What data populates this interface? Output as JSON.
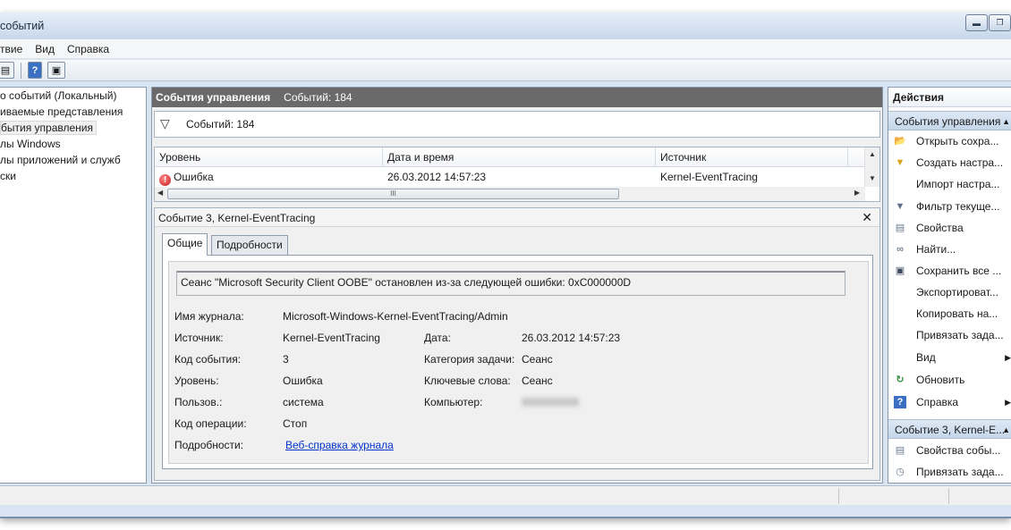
{
  "window": {
    "title": "событий"
  },
  "menubar": {
    "items": [
      "твие",
      "Вид",
      "Справка"
    ]
  },
  "tree": {
    "items": [
      {
        "label": "о событий (Локальный)",
        "selected": false
      },
      {
        "label": "иваемые представления",
        "selected": false
      },
      {
        "label": "бытия управления",
        "selected": true
      },
      {
        "label": "лы Windows",
        "selected": false
      },
      {
        "label": "лы приложений и служб",
        "selected": false
      },
      {
        "label": "ски",
        "selected": false
      }
    ]
  },
  "center": {
    "header_title": "События управления",
    "header_count": "Событий: 184",
    "filter_text": "Событий: 184",
    "columns": [
      "Уровень",
      "Дата и время",
      "Источник"
    ],
    "rows": [
      {
        "level": "Ошибка",
        "datetime": "26.03.2012 14:57:23",
        "source": "Kernel-EventTracing"
      }
    ],
    "hscroll_thumb": "III"
  },
  "detail": {
    "title": "Событие 3, Kernel-EventTracing",
    "close": "✕",
    "tabs": [
      "Общие",
      "Подробности"
    ],
    "message": "Сеанс \"Microsoft Security Client OOBE\" остановлен из-за следующей ошибки: 0xC000000D",
    "fields": {
      "log_name_label": "Имя журнала:",
      "log_name_value": "Microsoft-Windows-Kernel-EventTracing/Admin",
      "source_label": "Источник:",
      "source_value": "Kernel-EventTracing",
      "date_label": "Дата:",
      "date_value": "26.03.2012 14:57:23",
      "event_id_label": "Код события:",
      "event_id_value": "3",
      "task_category_label": "Категория задачи:",
      "task_category_value": "Сеанс",
      "level_label": "Уровень:",
      "level_value": "Ошибка",
      "keywords_label": "Ключевые слова:",
      "keywords_value": "Сеанс",
      "user_label": "Пользов.:",
      "user_value": "система",
      "computer_label": "Компьютер:",
      "computer_value": "XXXXXXXX",
      "opcode_label": "Код операции:",
      "opcode_value": "Стоп",
      "details_label": "Подробности:",
      "details_link": "Веб-справка журнала"
    }
  },
  "actions": {
    "title": "Действия",
    "section1": "События управления",
    "section1_items": [
      {
        "label": "Открыть сохра...",
        "icon": "open-folder-icon"
      },
      {
        "label": "Создать настра...",
        "icon": "create-view-filter-icon"
      },
      {
        "label": "Импорт настра...",
        "icon": "none"
      },
      {
        "label": "Фильтр текуще...",
        "icon": "filter-icon"
      },
      {
        "label": "Свойства",
        "icon": "properties-icon"
      },
      {
        "label": "Найти...",
        "icon": "binoculars-icon"
      },
      {
        "label": "Сохранить все ...",
        "icon": "save-icon"
      },
      {
        "label": "Экспортироват...",
        "icon": "none"
      },
      {
        "label": "Копировать на...",
        "icon": "none"
      },
      {
        "label": "Привязать зада...",
        "icon": "none"
      },
      {
        "label": "Вид",
        "icon": "none",
        "submenu": true
      },
      {
        "label": "Обновить",
        "icon": "refresh-icon"
      },
      {
        "label": "Справка",
        "icon": "help-icon",
        "submenu": true
      }
    ],
    "section2": "Событие 3, Kernel-E...",
    "section2_items": [
      {
        "label": "Свойства собы...",
        "icon": "event-properties-icon"
      },
      {
        "label": "Привязать зада...",
        "icon": "attach-task-icon"
      }
    ]
  },
  "colors": {
    "header_bg": "#6a6a6a",
    "section_bg": "#c5d6ea",
    "link": "#0033cc",
    "error": "#c61a1a"
  }
}
